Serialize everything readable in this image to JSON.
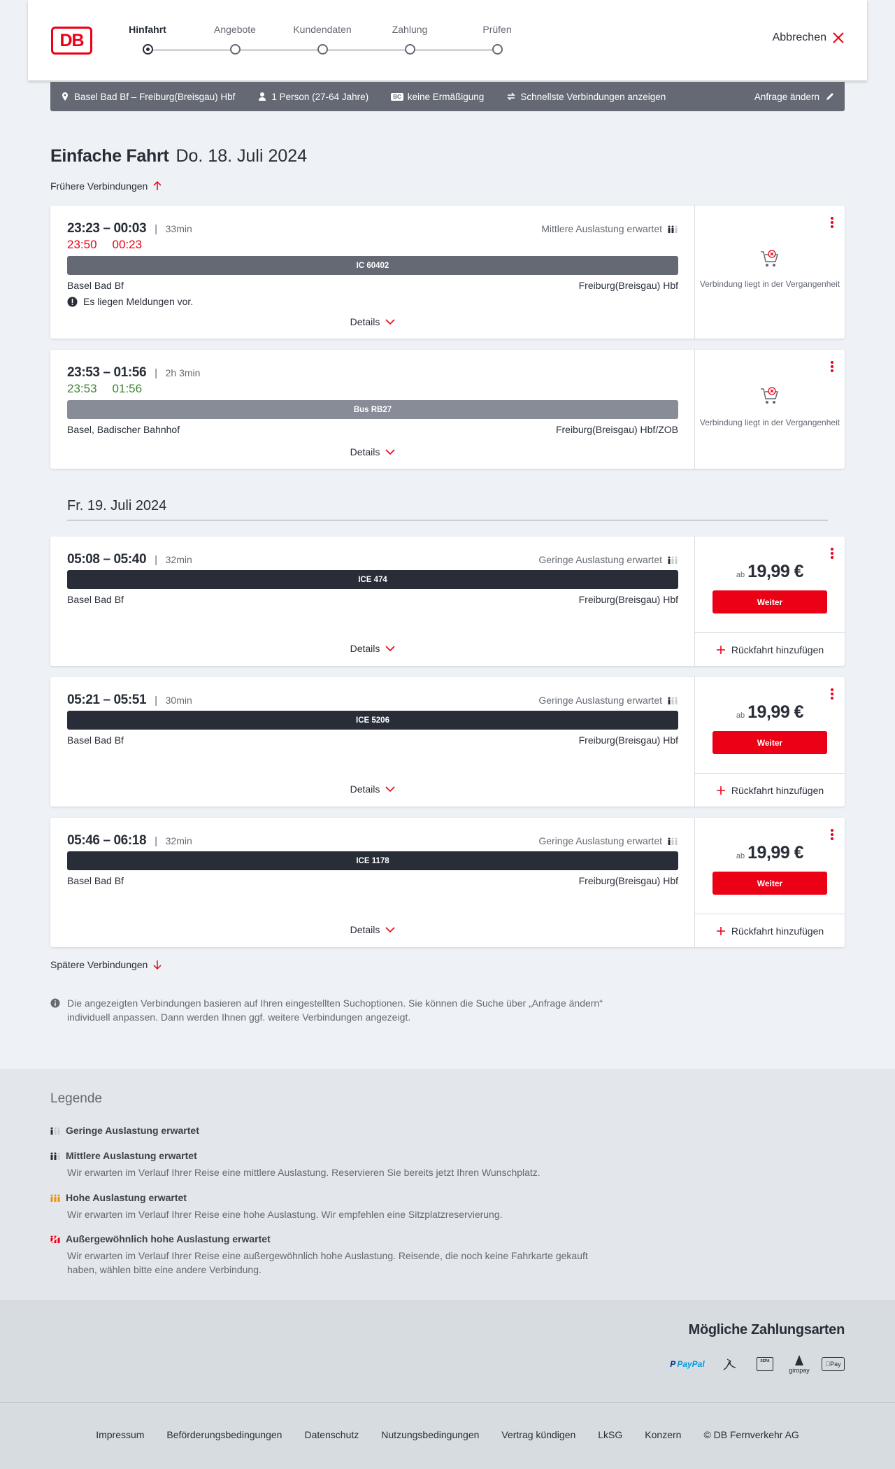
{
  "header": {
    "logo": "DB",
    "steps": [
      "Hinfahrt",
      "Angebote",
      "Kundendaten",
      "Zahlung",
      "Prüfen"
    ],
    "active_step": "Hinfahrt",
    "cancel": "Abbrechen"
  },
  "infobar": {
    "route": "Basel Bad Bf – Freiburg(Breisgau) Hbf",
    "passengers": "1 Person (27-64 Jahre)",
    "discount_badge": "BC",
    "discount": "keine Ermäßigung",
    "option": "Schnellste Verbindungen anzeigen",
    "change": "Anfrage ändern"
  },
  "title": {
    "main": "Einfache Fahrt",
    "date": "Do. 18. Juli 2024"
  },
  "earlier": "Frühere Verbindungen",
  "later": "Spätere Verbindungen",
  "day_separator": "Fr. 19. Juli 2024",
  "connections": [
    {
      "times": "23:23 – 00:03",
      "duration": "33min",
      "realtime_dep": "23:50",
      "realtime_arr": "00:23",
      "realtime_color": "#ec0016",
      "load": "Mittlere Auslastung erwartet",
      "train": "IC 60402",
      "from": "Basel Bad Bf",
      "to": "Freiburg(Breisgau) Hbf",
      "message": "Es liegen Meldungen vor.",
      "details": "Details",
      "past_text": "Verbindung liegt in der Vergangenheit"
    },
    {
      "times": "23:53 – 01:56",
      "duration": "2h 3min",
      "realtime_dep": "23:53",
      "realtime_arr": "01:56",
      "realtime_color": "#408335",
      "train": "Bus RB27",
      "from": "Basel, Badischer Bahnhof",
      "to": "Freiburg(Breisgau) Hbf/ZOB",
      "details": "Details",
      "past_text": "Verbindung liegt in der Vergangenheit"
    },
    {
      "times": "05:08 – 05:40",
      "duration": "32min",
      "load": "Geringe Auslastung erwartet",
      "train": "ICE 474",
      "from": "Basel Bad Bf",
      "to": "Freiburg(Breisgau) Hbf",
      "details": "Details",
      "price_prefix": "ab",
      "price": "19,99 €",
      "button": "Weiter",
      "return": "Rückfahrt hinzufügen"
    },
    {
      "times": "05:21 – 05:51",
      "duration": "30min",
      "load": "Geringe Auslastung erwartet",
      "train": "ICE 5206",
      "from": "Basel Bad Bf",
      "to": "Freiburg(Breisgau) Hbf",
      "details": "Details",
      "price_prefix": "ab",
      "price": "19,99 €",
      "button": "Weiter",
      "return": "Rückfahrt hinzufügen"
    },
    {
      "times": "05:46 – 06:18",
      "duration": "32min",
      "load": "Geringe Auslastung erwartet",
      "train": "ICE 1178",
      "from": "Basel Bad Bf",
      "to": "Freiburg(Breisgau) Hbf",
      "details": "Details",
      "price_prefix": "ab",
      "price": "19,99 €",
      "button": "Weiter",
      "return": "Rückfahrt hinzufügen"
    }
  ],
  "note": "Die angezeigten Verbindungen basieren auf Ihren eingestellten Suchoptionen. Sie können die Suche über „Anfrage ändern“ individuell anpassen. Dann werden Ihnen ggf. weitere Verbindungen angezeigt.",
  "legend": {
    "title": "Legende",
    "items": [
      {
        "label": "Geringe Auslastung erwartet",
        "text": ""
      },
      {
        "label": "Mittlere Auslastung erwartet",
        "text": "Wir erwarten im Verlauf Ihrer Reise eine mittlere Auslastung. Reservieren Sie bereits jetzt Ihren Wunschplatz."
      },
      {
        "label": "Hohe Auslastung erwartet",
        "text": "Wir erwarten im Verlauf Ihrer Reise eine hohe Auslastung. Wir empfehlen eine Sitzplatzreservierung."
      },
      {
        "label": "Außergewöhnlich hohe Auslastung erwartet",
        "text": "Wir erwarten im Verlauf Ihrer Reise eine außergewöhnlich hohe Auslastung. Reisende, die noch keine Fahrkarte gekauft haben, wählen bitte eine andere Verbindung."
      }
    ]
  },
  "payments": {
    "title": "Mögliche Zahlungsarten",
    "paypal": "PayPal",
    "sepa": "SEPA",
    "giropay": "giropay",
    "applepay": "Pay"
  },
  "footer": [
    "Impressum",
    "Beförderungsbedingungen",
    "Datenschutz",
    "Nutzungsbedingungen",
    "Vertrag kündigen",
    "LkSG",
    "Konzern",
    "© DB Fernverkehr AG"
  ],
  "colors": {
    "accent": "#ec0016",
    "dark": "#282d37",
    "grey": "#646973",
    "green": "#408335"
  }
}
